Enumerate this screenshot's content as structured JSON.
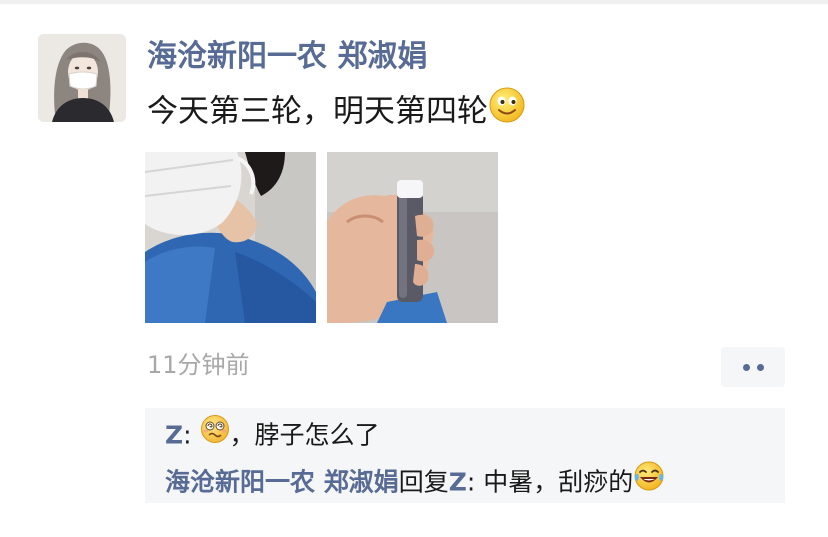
{
  "post": {
    "author": "海沧新阳一农 郑淑娟",
    "text": "今天第三轮，明天第四轮",
    "text_emoji": "smile-emoji",
    "photos": [
      "photo-person-in-mask-blue-gown",
      "photo-hand-holding-vial"
    ],
    "time": "11分钟前",
    "more_icon": "more-dots-icon"
  },
  "comments": [
    {
      "author": "Z",
      "separator": ": ",
      "emoji": "dizzy-face-emoji",
      "text": "，脖子怎么了"
    },
    {
      "author": "海沧新阳一农 郑淑娟",
      "reply_word": "回复",
      "reply_to": "Z",
      "separator": ": ",
      "text": "中暑，刮痧的",
      "emoji": "laughing-tears-emoji"
    }
  ],
  "colors": {
    "name": "#576b95",
    "text": "#1a1a1a",
    "time": "#a8a8a8",
    "comment_bg": "#f5f6f8"
  }
}
